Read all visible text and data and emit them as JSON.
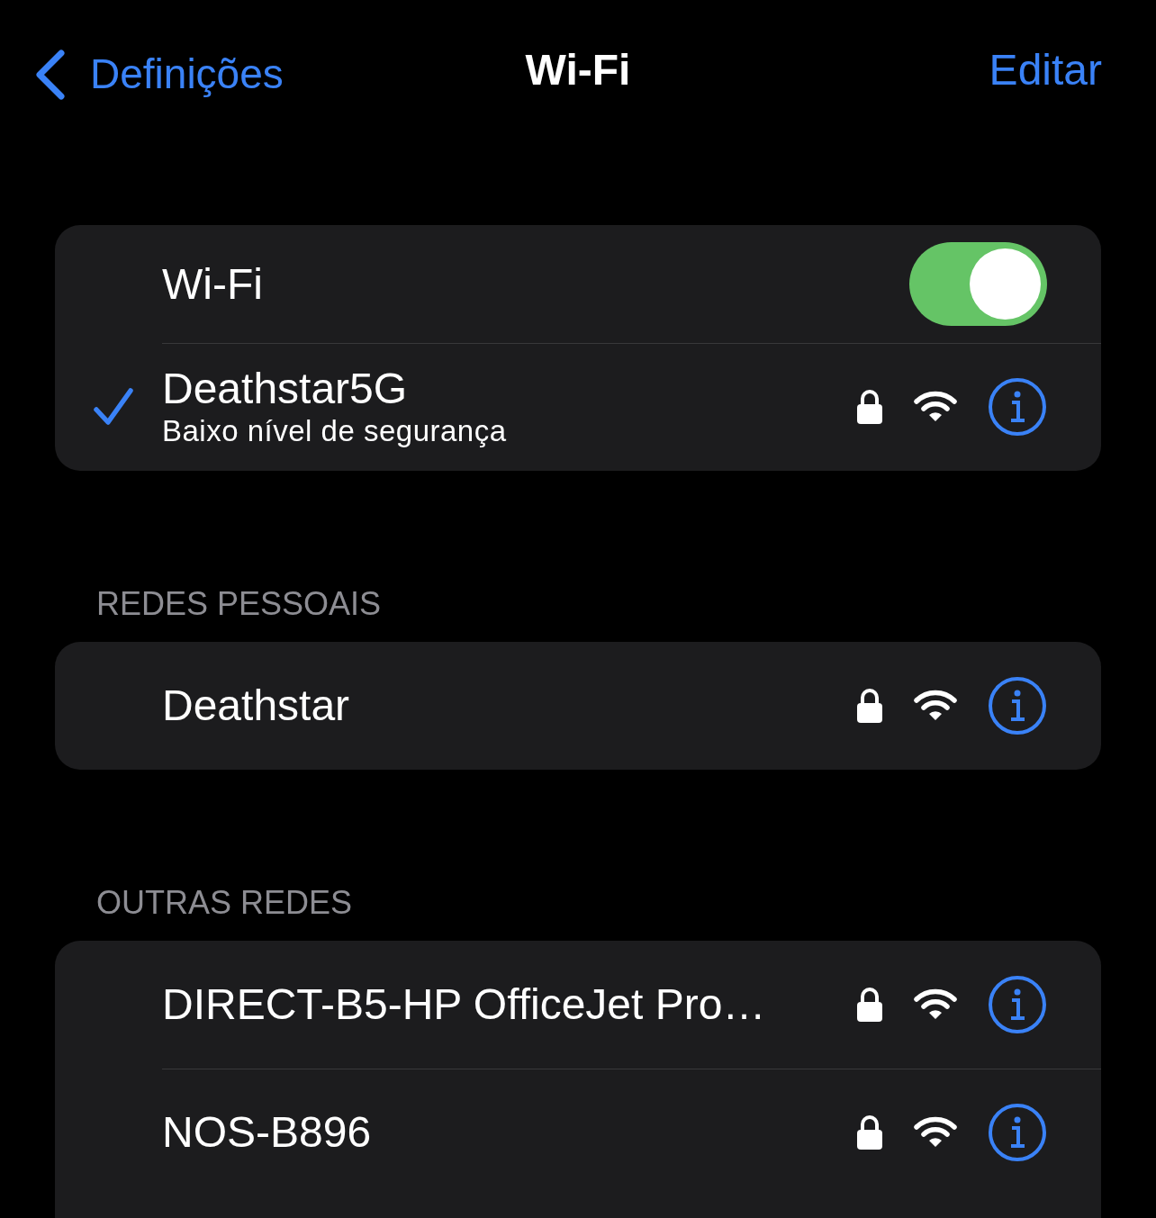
{
  "nav": {
    "back": "Definições",
    "title": "Wi-Fi",
    "action": "Editar"
  },
  "groups": [
    {
      "rows": [
        {
          "kind": "toggle",
          "label": "Wi-Fi",
          "on": true
        },
        {
          "kind": "network",
          "name": "Deathstar5G",
          "subtitle": "Baixo nível de segurança",
          "selected": true,
          "locked": true
        }
      ]
    },
    {
      "header": "REDES PESSOAIS",
      "rows": [
        {
          "kind": "network",
          "name": "Deathstar",
          "selected": false,
          "locked": true
        }
      ]
    },
    {
      "header": "OUTRAS REDES",
      "rows": [
        {
          "kind": "network",
          "name": "DIRECT-B5-HP OfficeJet Pro…",
          "selected": false,
          "locked": true
        },
        {
          "kind": "network",
          "name": "NOS-B896",
          "selected": false,
          "locked": true
        }
      ]
    }
  ]
}
